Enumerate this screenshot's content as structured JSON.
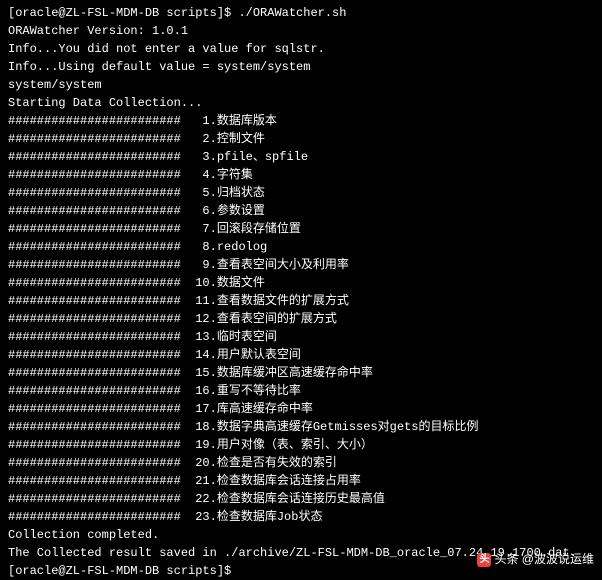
{
  "prompt1": "[oracle@ZL-FSL-MDM-DB scripts]$ ./ORAWatcher.sh",
  "blank": "",
  "version": "ORAWatcher Version: 1.0.1",
  "info1": "Info...You did not enter a value for sqlstr.",
  "info2": "Info...Using default value = system/system",
  "info3": "system/system",
  "starting": "Starting Data Collection...",
  "hashes": "########################",
  "items": [
    {
      "num": "1",
      "label": "数据库版本"
    },
    {
      "num": "2",
      "label": "控制文件"
    },
    {
      "num": "3",
      "label": "pfile、spfile"
    },
    {
      "num": "4",
      "label": "字符集"
    },
    {
      "num": "5",
      "label": "归档状态"
    },
    {
      "num": "6",
      "label": "参数设置"
    },
    {
      "num": "7",
      "label": "回滚段存储位置"
    },
    {
      "num": "8",
      "label": "redolog"
    },
    {
      "num": "9",
      "label": "查看表空间大小及利用率"
    },
    {
      "num": "10",
      "label": "数据文件"
    },
    {
      "num": "11",
      "label": "查看数据文件的扩展方式"
    },
    {
      "num": "12",
      "label": "查看表空间的扩展方式"
    },
    {
      "num": "13",
      "label": "临时表空间"
    },
    {
      "num": "14",
      "label": "用户默认表空间"
    },
    {
      "num": "15",
      "label": "数据库缓冲区高速缓存命中率"
    },
    {
      "num": "16",
      "label": "重写不等待比率"
    },
    {
      "num": "17",
      "label": "库高速缓存命中率"
    },
    {
      "num": "18",
      "label": "数据字典高速缓存Getmisses对gets的目标比例"
    },
    {
      "num": "19",
      "label": "用户对像（表、索引、大小）"
    },
    {
      "num": "20",
      "label": "检查是否有失效的索引"
    },
    {
      "num": "21",
      "label": "检查数据库会话连接占用率"
    },
    {
      "num": "22",
      "label": "检查数据库会话连接历史最高值"
    },
    {
      "num": "23",
      "label": "检查数据库Job状态"
    }
  ],
  "completed": "Collection completed.",
  "saved": "The Collected result saved in ./archive/ZL-FSL-MDM-DB_oracle_07.24.19.1700.dat.",
  "prompt2": "[oracle@ZL-FSL-MDM-DB scripts]$ ",
  "watermark": {
    "icon": "头",
    "text": "头条 @波波说运维"
  }
}
